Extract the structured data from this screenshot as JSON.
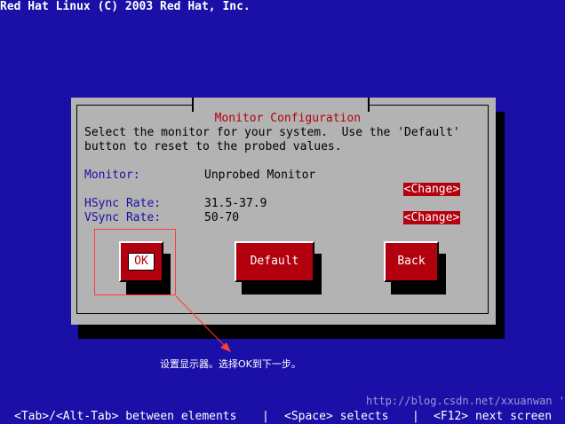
{
  "screen_title": "Red Hat Linux (C) 2003 Red Hat, Inc.",
  "dialog": {
    "title": "Monitor Configuration",
    "description_line1": "Select the monitor for your system.  Use the 'Default'",
    "description_line2": "button to reset to the probed values.",
    "monitor_label": "Monitor:",
    "monitor_value": "Unprobed Monitor",
    "hsync_label": "HSync Rate:",
    "hsync_value": "31.5-37.9",
    "vsync_label": "VSync Rate:",
    "vsync_value": "50-70",
    "change_label": "<Change>",
    "buttons": {
      "ok": "OK",
      "default": "Default",
      "back": "Back"
    }
  },
  "annotation": {
    "text": "设置显示器。选择OK到下一步。",
    "color": "#ff3a3a"
  },
  "watermark": "http://blog.csdn.net/xxuanwan 'a",
  "status_bar": {
    "tab_help": "<Tab>/<Alt-Tab> between elements",
    "separator": "|",
    "space_help": "<Space> selects",
    "f12_help": "<F12> next screen"
  },
  "colors": {
    "background": "#1a0fa6",
    "dialog": "#b3b3b3",
    "accent": "#b3000e",
    "label_blue": "#1a0fa6"
  }
}
